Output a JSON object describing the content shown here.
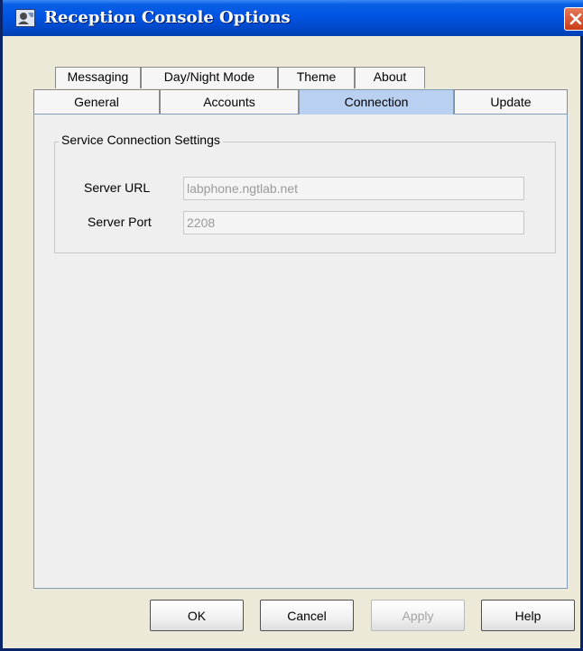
{
  "window": {
    "title": "Reception Console Options",
    "app_icon": "app-icon",
    "close_icon": "close-icon"
  },
  "tabs": {
    "back_row": [
      {
        "label": "Messaging",
        "selected": false
      },
      {
        "label": "Day/Night Mode",
        "selected": false
      },
      {
        "label": "Theme",
        "selected": false
      },
      {
        "label": "About",
        "selected": false
      }
    ],
    "front_row": [
      {
        "label": "General",
        "selected": false
      },
      {
        "label": "Accounts",
        "selected": false
      },
      {
        "label": "Connection",
        "selected": true
      },
      {
        "label": "Update",
        "selected": false
      }
    ]
  },
  "connection": {
    "group_title": "Service Connection Settings",
    "server_url_label": "Server URL",
    "server_url_value": "labphone.ngtlab.net",
    "server_port_label": "Server Port",
    "server_port_value": "2208"
  },
  "buttons": {
    "ok": "OK",
    "cancel": "Cancel",
    "apply": "Apply",
    "help": "Help"
  },
  "colors": {
    "title_bar": "#0054e3",
    "selected_tab": "#b9d0f0",
    "close_button": "#c93b16"
  }
}
